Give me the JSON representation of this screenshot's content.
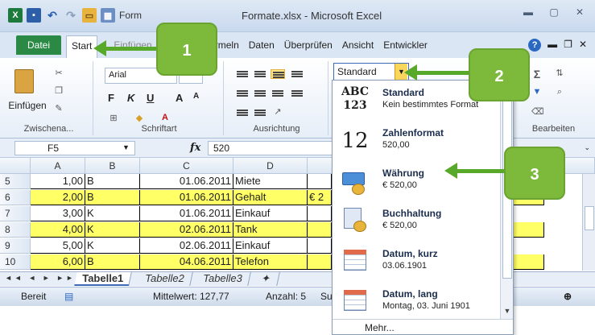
{
  "window": {
    "title": "Formate.xlsx - Microsoft Excel",
    "qat_partial_text": "Form"
  },
  "tabs": {
    "file": "Datei",
    "start": "Start",
    "insert_partial": "Einfügen",
    "formeln": "Formeln",
    "daten": "Daten",
    "ueberpruefen": "Überprüfen",
    "ansicht": "Ansicht",
    "entwickler": "Entwickler"
  },
  "ribbon": {
    "paste_label": "Einfügen",
    "clipboard_group": "Zwischena...",
    "font_group": "Schriftart",
    "alignment_group": "Ausrichtung",
    "edit_group": "Bearbeiten",
    "font_name": "Arial",
    "number_format": "Standard",
    "bold": "F",
    "italic": "K",
    "underline": "U",
    "grow_font": "A",
    "shrink_font": "A"
  },
  "formula_bar": {
    "name_box": "F5",
    "fx_label": "fx",
    "value": "520"
  },
  "grid": {
    "columns": [
      "A",
      "B",
      "C",
      "D"
    ],
    "rows": [
      {
        "num": "5",
        "a": "1,00",
        "b": "B",
        "c": "01.06.2011",
        "d": "Miete",
        "yellow": false,
        "e": ""
      },
      {
        "num": "6",
        "a": "2,00",
        "b": "B",
        "c": "01.06.2011",
        "d": "Gehalt",
        "yellow": true,
        "e": "€  2"
      },
      {
        "num": "7",
        "a": "3,00",
        "b": "K",
        "c": "01.06.2011",
        "d": "Einkauf",
        "yellow": false,
        "e": ""
      },
      {
        "num": "8",
        "a": "4,00",
        "b": "K",
        "c": "02.06.2011",
        "d": "Tank",
        "yellow": true,
        "e": ""
      },
      {
        "num": "9",
        "a": "5,00",
        "b": "K",
        "c": "02.06.2011",
        "d": "Einkauf",
        "yellow": false,
        "e": ""
      },
      {
        "num": "10",
        "a": "6,00",
        "b": "B",
        "c": "04.06.2011",
        "d": "Telefon",
        "yellow": true,
        "e": ""
      }
    ]
  },
  "sheets": [
    "Tabelle1",
    "Tabelle2",
    "Tabelle3"
  ],
  "statusbar": {
    "mode": "Bereit",
    "average": "Mittelwert: 127,77",
    "count": "Anzahl: 5",
    "sum_partial": "Su"
  },
  "dropdown": {
    "items": [
      {
        "title": "Standard",
        "sub": "Kein bestimmtes Format",
        "icon": "abc-123-icon"
      },
      {
        "title": "Zahlenformat",
        "sub": "520,00",
        "icon": "number-12-icon"
      },
      {
        "title": "Währung",
        "sub": "€ 520,00",
        "icon": "currency-icon"
      },
      {
        "title": "Buchhaltung",
        "sub": "€ 520,00",
        "icon": "accounting-icon"
      },
      {
        "title": "Datum, kurz",
        "sub": "03.06.1901",
        "icon": "calendar-short-icon"
      },
      {
        "title": "Datum, lang",
        "sub": "Montag, 03. Juni 1901",
        "icon": "calendar-long-icon"
      }
    ],
    "more": "Mehr..."
  },
  "callouts": [
    "1",
    "2",
    "3"
  ],
  "colors": {
    "callout": "#7dba3c",
    "arrow": "#58a82a",
    "highlight_row": "#ffff66",
    "file_tab": "#2a8a45"
  }
}
